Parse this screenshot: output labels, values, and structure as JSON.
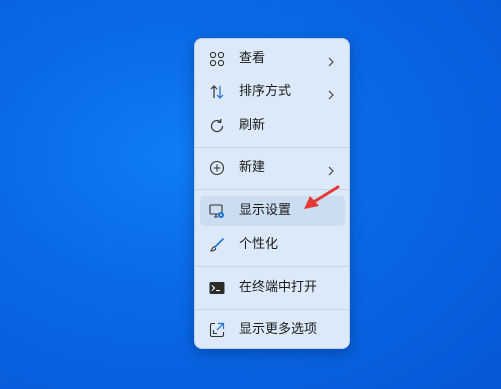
{
  "context_menu": {
    "items": [
      {
        "label": "查看",
        "icon": "grid-icon",
        "submenu": true
      },
      {
        "label": "排序方式",
        "icon": "sort-arrows-icon",
        "submenu": true
      },
      {
        "label": "刷新",
        "icon": "refresh-icon",
        "submenu": false
      },
      {
        "label": "新建",
        "icon": "plus-circle-icon",
        "submenu": true
      },
      {
        "label": "显示设置",
        "icon": "display-settings-icon",
        "submenu": false,
        "hovered": true
      },
      {
        "label": "个性化",
        "icon": "brush-icon",
        "submenu": false
      },
      {
        "label": "在终端中打开",
        "icon": "terminal-icon",
        "submenu": false
      },
      {
        "label": "显示更多选项",
        "icon": "more-options-icon",
        "submenu": false
      }
    ]
  },
  "annotation": {
    "icon": "red-arrow-pointer",
    "color": "#e53935"
  },
  "colors": {
    "desktop": "#0a6ae6",
    "menu_background": "#dce9f8",
    "hover": "#ccdcf1",
    "accent": "#1f6fd6"
  }
}
